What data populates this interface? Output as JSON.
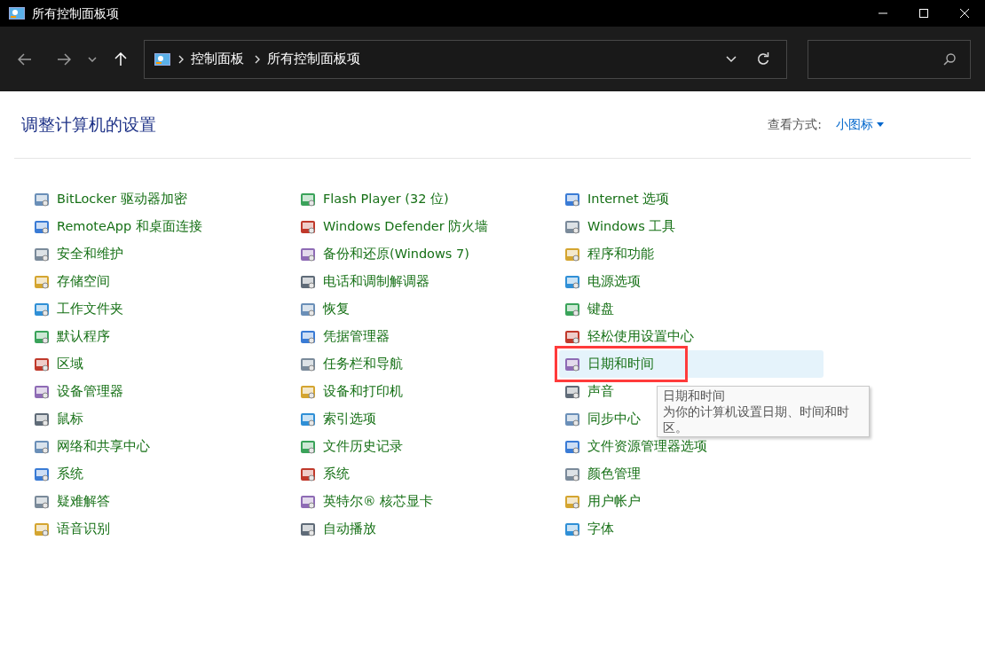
{
  "window": {
    "title": "所有控制面板项"
  },
  "address_bar": {
    "breadcrumbs": [
      "控制面板",
      "所有控制面板项"
    ]
  },
  "header": {
    "title": "调整计算机的设置",
    "view_label": "查看方式:",
    "view_value": "小图标"
  },
  "columns": [
    {
      "items": [
        {
          "label": "BitLocker 驱动器加密",
          "hovered": false,
          "marked": false
        },
        {
          "label": "RemoteApp 和桌面连接",
          "hovered": false,
          "marked": false
        },
        {
          "label": "安全和维护",
          "hovered": false,
          "marked": false
        },
        {
          "label": "存储空间",
          "hovered": false,
          "marked": false
        },
        {
          "label": "工作文件夹",
          "hovered": false,
          "marked": false
        },
        {
          "label": "默认程序",
          "hovered": false,
          "marked": false
        },
        {
          "label": "区域",
          "hovered": false,
          "marked": false
        },
        {
          "label": "设备管理器",
          "hovered": false,
          "marked": false
        },
        {
          "label": "鼠标",
          "hovered": false,
          "marked": false
        },
        {
          "label": "网络和共享中心",
          "hovered": false,
          "marked": false
        },
        {
          "label": "系统",
          "hovered": false,
          "marked": false
        },
        {
          "label": "疑难解答",
          "hovered": false,
          "marked": false
        },
        {
          "label": "语音识别",
          "hovered": false,
          "marked": false
        }
      ]
    },
    {
      "items": [
        {
          "label": "Flash Player (32 位)",
          "hovered": false,
          "marked": false
        },
        {
          "label": "Windows Defender 防火墙",
          "hovered": false,
          "marked": false
        },
        {
          "label": "备份和还原(Windows 7)",
          "hovered": false,
          "marked": false
        },
        {
          "label": "电话和调制解调器",
          "hovered": false,
          "marked": false
        },
        {
          "label": "恢复",
          "hovered": false,
          "marked": false
        },
        {
          "label": "凭据管理器",
          "hovered": false,
          "marked": false
        },
        {
          "label": "任务栏和导航",
          "hovered": false,
          "marked": false
        },
        {
          "label": "设备和打印机",
          "hovered": false,
          "marked": false
        },
        {
          "label": "索引选项",
          "hovered": false,
          "marked": false
        },
        {
          "label": "文件历史记录",
          "hovered": false,
          "marked": false
        },
        {
          "label": "系统",
          "hovered": false,
          "marked": false
        },
        {
          "label": "英特尔® 核芯显卡",
          "hovered": false,
          "marked": false
        },
        {
          "label": "自动播放",
          "hovered": false,
          "marked": false
        }
      ]
    },
    {
      "items": [
        {
          "label": "Internet 选项",
          "hovered": false,
          "marked": false
        },
        {
          "label": "Windows 工具",
          "hovered": false,
          "marked": false
        },
        {
          "label": "程序和功能",
          "hovered": false,
          "marked": false
        },
        {
          "label": "电源选项",
          "hovered": false,
          "marked": false
        },
        {
          "label": "键盘",
          "hovered": false,
          "marked": false
        },
        {
          "label": "轻松使用设置中心",
          "hovered": false,
          "marked": false
        },
        {
          "label": "日期和时间",
          "hovered": true,
          "marked": true
        },
        {
          "label": "声音",
          "hovered": false,
          "marked": false
        },
        {
          "label": "同步中心",
          "hovered": false,
          "marked": false
        },
        {
          "label": "文件资源管理器选项",
          "hovered": false,
          "marked": false
        },
        {
          "label": "颜色管理",
          "hovered": false,
          "marked": false
        },
        {
          "label": "用户帐户",
          "hovered": false,
          "marked": false
        },
        {
          "label": "字体",
          "hovered": false,
          "marked": false
        }
      ]
    }
  ],
  "tooltip": {
    "title": "日期和时间",
    "text": "为你的计算机设置日期、时间和时区。"
  }
}
